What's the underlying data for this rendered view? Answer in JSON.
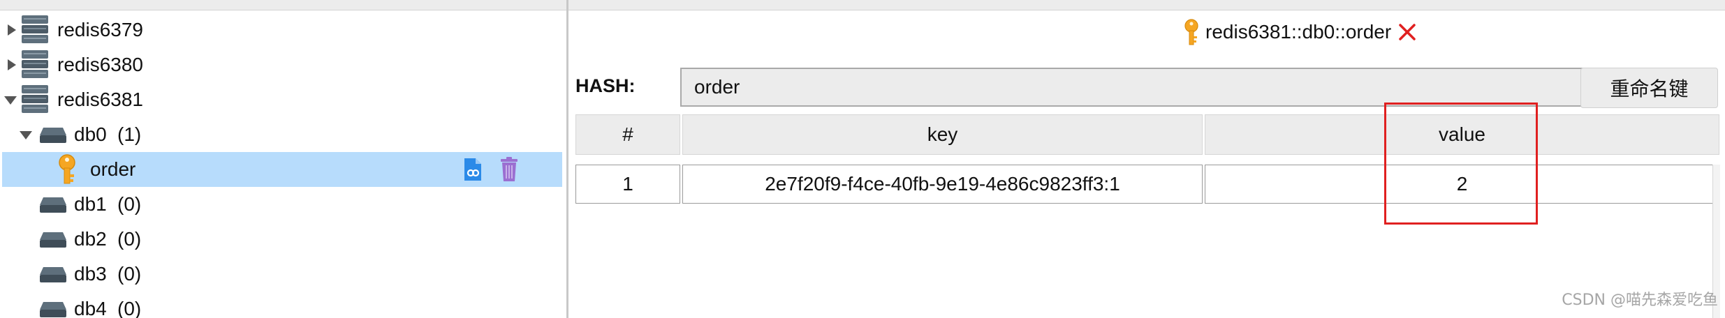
{
  "tree": {
    "servers": [
      {
        "name": "redis6379",
        "expanded": false
      },
      {
        "name": "redis6380",
        "expanded": false
      },
      {
        "name": "redis6381",
        "expanded": true
      }
    ],
    "databases": [
      {
        "name": "db0",
        "count": "(1)",
        "expanded": true
      },
      {
        "name": "db1",
        "count": "(0)"
      },
      {
        "name": "db2",
        "count": "(0)"
      },
      {
        "name": "db3",
        "count": "(0)"
      },
      {
        "name": "db4",
        "count": "(0)"
      }
    ],
    "selected_key": {
      "name": "order",
      "icon": "key-icon"
    },
    "row_actions": [
      "copy-link-icon",
      "delete-icon"
    ]
  },
  "tab": {
    "title": "redis6381::db0::order",
    "icon": "key-icon",
    "close_icon": "close-icon"
  },
  "editor": {
    "type_label": "HASH:",
    "key_name": "order",
    "rename_label": "重命名键"
  },
  "table": {
    "columns": [
      "#",
      "key",
      "value"
    ],
    "rows": [
      {
        "index": "1",
        "key": "2e7f20f9-f4ce-40fb-9e19-4e86c9823ff3:1",
        "value": "2"
      }
    ]
  },
  "colors": {
    "selection": "#b7dcfc",
    "highlight": "#e02020",
    "key_icon": "#f5a623",
    "trash_icon": "#9b6fd1",
    "link_icon": "#2b8ae8"
  },
  "watermark": "CSDN @喵先森爱吃鱼"
}
